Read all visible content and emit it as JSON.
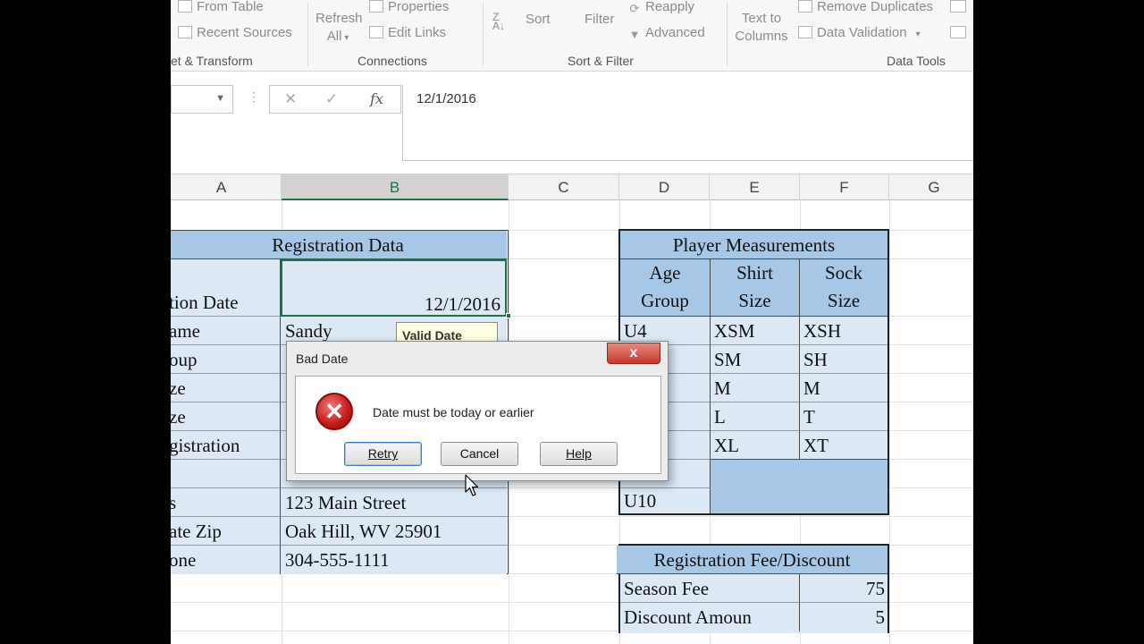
{
  "ribbon": {
    "get_transform": {
      "from_table": "From Table",
      "recent_sources": "Recent Sources",
      "group_label": "et & Transform"
    },
    "connections": {
      "refresh_all_line1": "Refresh",
      "refresh_all_line2": "All",
      "properties": "Properties",
      "edit_links": "Edit Links",
      "group_label": "Connections"
    },
    "sort_filter": {
      "sort": "Sort",
      "filter": "Filter",
      "reapply": "Reapply",
      "advanced": "Advanced",
      "group_label": "Sort & Filter"
    },
    "data_tools": {
      "text_to_columns_line1": "Text to",
      "text_to_columns_line2": "Columns",
      "remove_duplicates": "Remove Duplicates",
      "data_validation": "Data Validation",
      "group_label": "Data Tools"
    }
  },
  "formula_bar": {
    "cancel_symbol": "✕",
    "enter_symbol": "✓",
    "fx_label": "fx",
    "value": "12/1/2016"
  },
  "columns": [
    "A",
    "B",
    "C",
    "D",
    "E",
    "F",
    "G"
  ],
  "registration": {
    "title": "Registration Data",
    "rows": [
      {
        "label": "tion Date",
        "value": "12/1/2016"
      },
      {
        "label": "ame",
        "value": "Sandy"
      },
      {
        "label": "oup",
        "value": ""
      },
      {
        "label": "ze",
        "value": ""
      },
      {
        "label": "ze",
        "value": ""
      },
      {
        "label": "gistration",
        "value": ""
      },
      {
        "label": "",
        "value": ""
      },
      {
        "label": "s",
        "value": "123 Main Street"
      },
      {
        "label": "ate Zip",
        "value": "Oak Hill, WV 25901"
      },
      {
        "label": "one",
        "value": "304-555-1111"
      }
    ],
    "tooltip": "Valid Date"
  },
  "measurements": {
    "title": "Player Measurements",
    "headers": [
      [
        "Age",
        "Group"
      ],
      [
        "Shirt",
        "Size"
      ],
      [
        "Sock",
        "Size"
      ]
    ],
    "rows": [
      [
        "U4",
        "XSM",
        "XSH"
      ],
      [
        "",
        "SM",
        "SH"
      ],
      [
        "",
        "M",
        "M"
      ],
      [
        "",
        "L",
        "T"
      ],
      [
        "",
        "XL",
        "XT"
      ],
      [
        "",
        "",
        ""
      ],
      [
        "U10",
        "",
        ""
      ]
    ]
  },
  "fees": {
    "title": "Registration Fee/Discount",
    "rows": [
      {
        "label": "Season Fee",
        "value": "75"
      },
      {
        "label": "Discount Amoun",
        "value": "5"
      }
    ]
  },
  "dialog": {
    "title": "Bad Date",
    "close_symbol": "x",
    "icon_symbol": "✕",
    "message": "Date must be today or earlier",
    "retry": "Retry",
    "cancel": "Cancel",
    "help": "Help"
  },
  "colors": {
    "header_fill": "#a7c7e7",
    "cell_fill": "#dce9f5",
    "excel_green": "#217346"
  }
}
